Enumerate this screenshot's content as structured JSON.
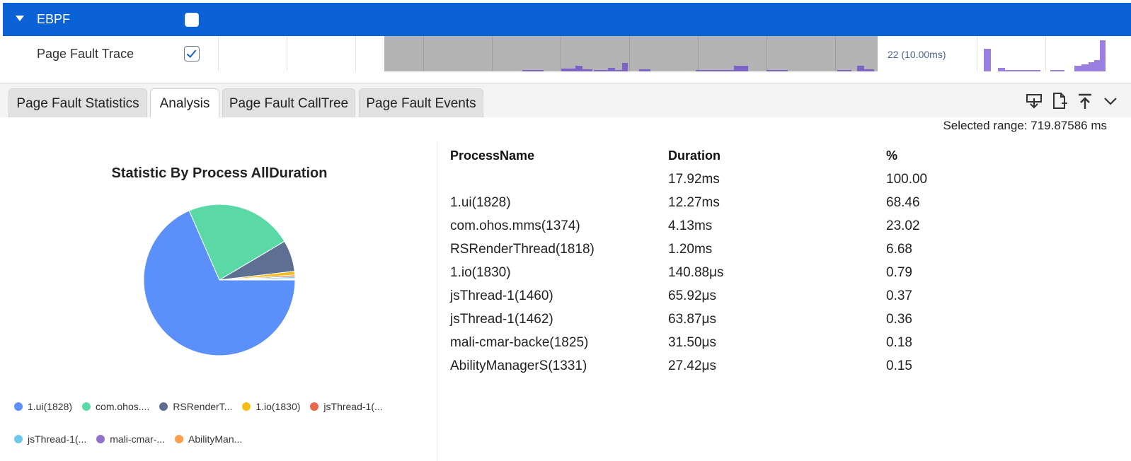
{
  "trace": {
    "group_label": "EBPF",
    "row_label": "Page Fault Trace",
    "tooltip": "22 (10.00ms)"
  },
  "tabs": [
    {
      "label": "Page Fault Statistics",
      "active": false
    },
    {
      "label": "Analysis",
      "active": true
    },
    {
      "label": "Page Fault CallTree",
      "active": false
    },
    {
      "label": "Page Fault Events",
      "active": false
    }
  ],
  "toolbar_icons": [
    "download-icon",
    "export-file-icon",
    "upload-top-icon",
    "chevron-down-icon"
  ],
  "selected_range": "Selected range: 719.87586 ms",
  "chart_data": {
    "type": "pie",
    "title": "Statistic By Process AllDuration",
    "slices": [
      {
        "label": "1.ui(1828)",
        "legend": "1.ui(1828)",
        "value": 68.46,
        "color": "#5b8ff9"
      },
      {
        "label": "com.ohos.mms(1374)",
        "legend": "com.ohos....",
        "value": 23.02,
        "color": "#5ad8a6"
      },
      {
        "label": "RSRenderThread(1818)",
        "legend": "RSRenderT...",
        "value": 6.68,
        "color": "#5d7092"
      },
      {
        "label": "1.io(1830)",
        "legend": "1.io(1830)",
        "value": 0.79,
        "color": "#f6bd16"
      },
      {
        "label": "jsThread-1(1460)",
        "legend": "jsThread-1(...",
        "value": 0.37,
        "color": "#e8684a"
      },
      {
        "label": "jsThread-1(1462)",
        "legend": "jsThread-1(...",
        "value": 0.36,
        "color": "#6dc8ec"
      },
      {
        "label": "mali-cmar-backe(1825)",
        "legend": "mali-cmar-...",
        "value": 0.18,
        "color": "#9270ca"
      },
      {
        "label": "AbilityManagerS(1331)",
        "legend": "AbilityMan...",
        "value": 0.15,
        "color": "#ff9d4d"
      }
    ]
  },
  "table": {
    "headers": [
      "ProcessName",
      "Duration",
      "%"
    ],
    "rows": [
      [
        "",
        "17.92ms",
        "100.00"
      ],
      [
        "1.ui(1828)",
        "12.27ms",
        "68.46"
      ],
      [
        "com.ohos.mms(1374)",
        "4.13ms",
        "23.02"
      ],
      [
        "RSRenderThread(1818)",
        "1.20ms",
        "6.68"
      ],
      [
        "1.io(1830)",
        "140.88μs",
        "0.79"
      ],
      [
        "jsThread-1(1460)",
        "65.92μs",
        "0.37"
      ],
      [
        "jsThread-1(1462)",
        "63.87μs",
        "0.36"
      ],
      [
        "mali-cmar-backe(1825)",
        "31.50μs",
        "0.18"
      ],
      [
        "AbilityManagerS(1331)",
        "27.42μs",
        "0.15"
      ]
    ]
  }
}
